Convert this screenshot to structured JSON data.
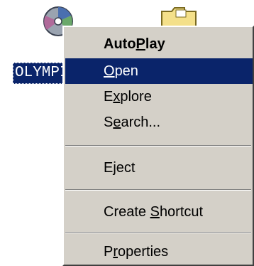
{
  "desktop": {
    "drive_label": "OLYMPI",
    "icons": [
      "cd-drive-icon",
      "folder-icon"
    ]
  },
  "context_menu": {
    "items": [
      {
        "id": "autoplay",
        "pre": "Auto",
        "key": "P",
        "post": "lay",
        "bold": true
      },
      {
        "id": "open",
        "pre": "",
        "key": "O",
        "post": "pen",
        "selected": true
      },
      {
        "id": "explore",
        "pre": "E",
        "key": "x",
        "post": "plore"
      },
      {
        "id": "search",
        "pre": "S",
        "key": "e",
        "post": "arch..."
      },
      {
        "id": "eject",
        "pre": "Eject",
        "key": "",
        "post": ""
      },
      {
        "id": "create-shortcut",
        "pre": "Create ",
        "key": "S",
        "post": "hortcut"
      },
      {
        "id": "properties",
        "pre": "P",
        "key": "r",
        "post": "operties"
      }
    ]
  },
  "colors": {
    "menu_bg": "#d4d0c8",
    "selection": "#0a246a",
    "selection_text": "#ffffff"
  }
}
